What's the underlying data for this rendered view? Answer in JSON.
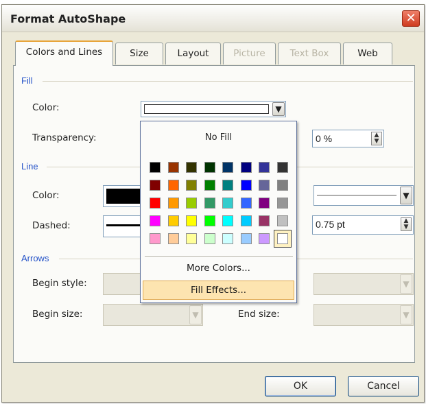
{
  "window": {
    "title": "Format AutoShape",
    "close_glyph": "✕"
  },
  "tabs": [
    {
      "label": "Colors and Lines",
      "active": true,
      "enabled": true
    },
    {
      "label": "Size",
      "enabled": true
    },
    {
      "label": "Layout",
      "enabled": true
    },
    {
      "label": "Picture",
      "enabled": false
    },
    {
      "label": "Text Box",
      "enabled": false
    },
    {
      "label": "Web",
      "enabled": true
    }
  ],
  "fill": {
    "section_label": "Fill",
    "color_label": "Color:",
    "color_value": "#ffffff",
    "transparency_label": "Transparency:",
    "transparency_value": "0 %"
  },
  "line": {
    "section_label": "Line",
    "color_label": "Color:",
    "color_value": "#000000",
    "dashed_label": "Dashed:",
    "weight_value": "0.75 pt"
  },
  "arrows": {
    "section_label": "Arrows",
    "begin_style_label": "Begin style:",
    "begin_size_label": "Begin size:",
    "end_size_label": "End size:"
  },
  "color_popup": {
    "no_fill_label": "No Fill",
    "swatches": [
      [
        "#000000",
        "#993300",
        "#333300",
        "#003300",
        "#003366",
        "#000080",
        "#333399",
        "#333333"
      ],
      [
        "#800000",
        "#ff6600",
        "#808000",
        "#008000",
        "#008080",
        "#0000ff",
        "#666699",
        "#808080"
      ],
      [
        "#ff0000",
        "#ff9900",
        "#99cc00",
        "#339966",
        "#33cccc",
        "#3366ff",
        "#800080",
        "#969696"
      ],
      [
        "#ff00ff",
        "#ffcc00",
        "#ffff00",
        "#00ff00",
        "#00ffff",
        "#00ccff",
        "#993366",
        "#c0c0c0"
      ],
      [
        "#ff99cc",
        "#ffcc99",
        "#ffff99",
        "#ccffcc",
        "#ccffff",
        "#99ccff",
        "#cc99ff",
        "#ffffff"
      ]
    ],
    "selected_color": "#ffffff",
    "more_colors_label": "More Colors...",
    "fill_effects_label": "Fill Effects..."
  },
  "buttons": {
    "ok_label": "OK",
    "cancel_label": "Cancel"
  }
}
